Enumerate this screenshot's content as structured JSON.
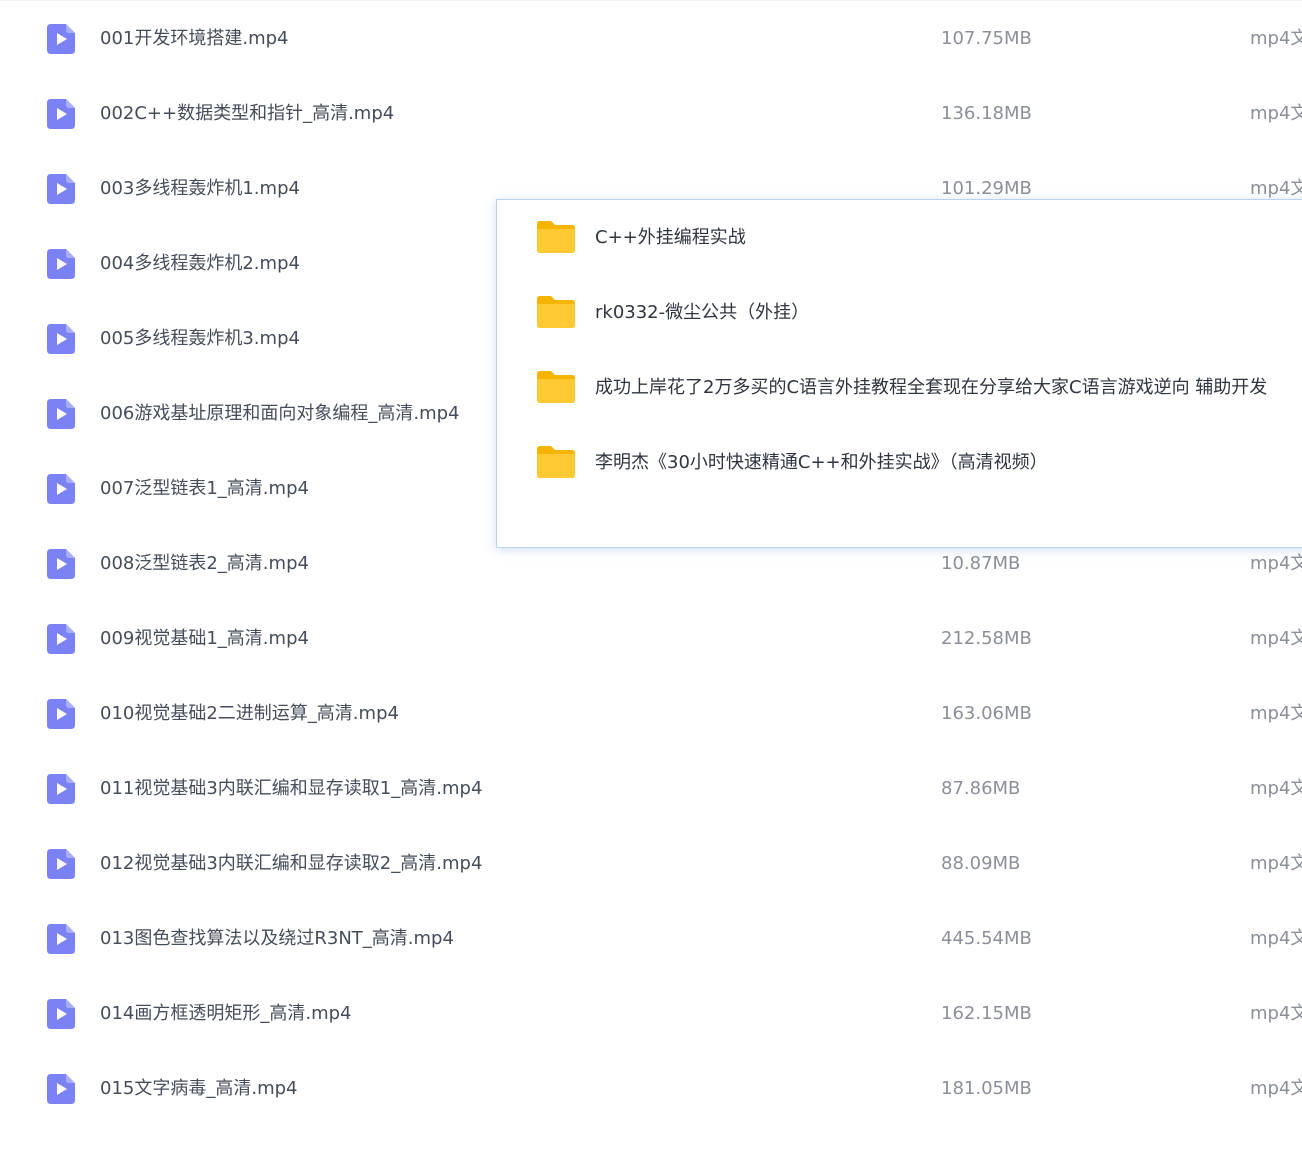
{
  "colors": {
    "video_icon": "#7b82f4",
    "folder_icon": "#ffc933",
    "name_text": "#454d5a",
    "meta_text": "#8a8f99",
    "popup_border": "#b9d3f7"
  },
  "files": [
    {
      "icon": "video-file-icon",
      "name": "001开发环境搭建.mp4",
      "size": "107.75MB",
      "type": "mp4文"
    },
    {
      "icon": "video-file-icon",
      "name": "002C++数据类型和指针_高清.mp4",
      "size": "136.18MB",
      "type": "mp4文"
    },
    {
      "icon": "video-file-icon",
      "name": "003多线程轰炸机1.mp4",
      "size": "101.29MB",
      "type": "mp4文"
    },
    {
      "icon": "video-file-icon",
      "name": "004多线程轰炸机2.mp4",
      "size": "",
      "type": ""
    },
    {
      "icon": "video-file-icon",
      "name": "005多线程轰炸机3.mp4",
      "size": "",
      "type": ""
    },
    {
      "icon": "video-file-icon",
      "name": "006游戏基址原理和面向对象编程_高清.mp4",
      "size": "",
      "type": ""
    },
    {
      "icon": "video-file-icon",
      "name": "007泛型链表1_高清.mp4",
      "size": "",
      "type": ""
    },
    {
      "icon": "video-file-icon",
      "name": "008泛型链表2_高清.mp4",
      "size": "10.87MB",
      "type": "mp4文"
    },
    {
      "icon": "video-file-icon",
      "name": "009视觉基础1_高清.mp4",
      "size": "212.58MB",
      "type": "mp4文"
    },
    {
      "icon": "video-file-icon",
      "name": "010视觉基础2二进制运算_高清.mp4",
      "size": "163.06MB",
      "type": "mp4文"
    },
    {
      "icon": "video-file-icon",
      "name": "011视觉基础3内联汇编和显存读取1_高清.mp4",
      "size": "87.86MB",
      "type": "mp4文"
    },
    {
      "icon": "video-file-icon",
      "name": "012视觉基础3内联汇编和显存读取2_高清.mp4",
      "size": "88.09MB",
      "type": "mp4文"
    },
    {
      "icon": "video-file-icon",
      "name": "013图色查找算法以及绕过R3NT_高清.mp4",
      "size": "445.54MB",
      "type": "mp4文"
    },
    {
      "icon": "video-file-icon",
      "name": "014画方框透明矩形_高清.mp4",
      "size": "162.15MB",
      "type": "mp4文"
    },
    {
      "icon": "video-file-icon",
      "name": "015文字病毒_高清.mp4",
      "size": "181.05MB",
      "type": "mp4文"
    }
  ],
  "popup": {
    "folders": [
      {
        "icon": "folder-icon",
        "name": "C++外挂编程实战"
      },
      {
        "icon": "folder-icon",
        "name": "rk0332-微尘公共（外挂）"
      },
      {
        "icon": "folder-icon",
        "name": "成功上岸花了2万多买的C语言外挂教程全套现在分享给大家C语言游戏逆向 辅助开发"
      },
      {
        "icon": "folder-icon",
        "name": "李明杰《30小时快速精通C++和外挂实战》（高清视频）"
      }
    ]
  }
}
